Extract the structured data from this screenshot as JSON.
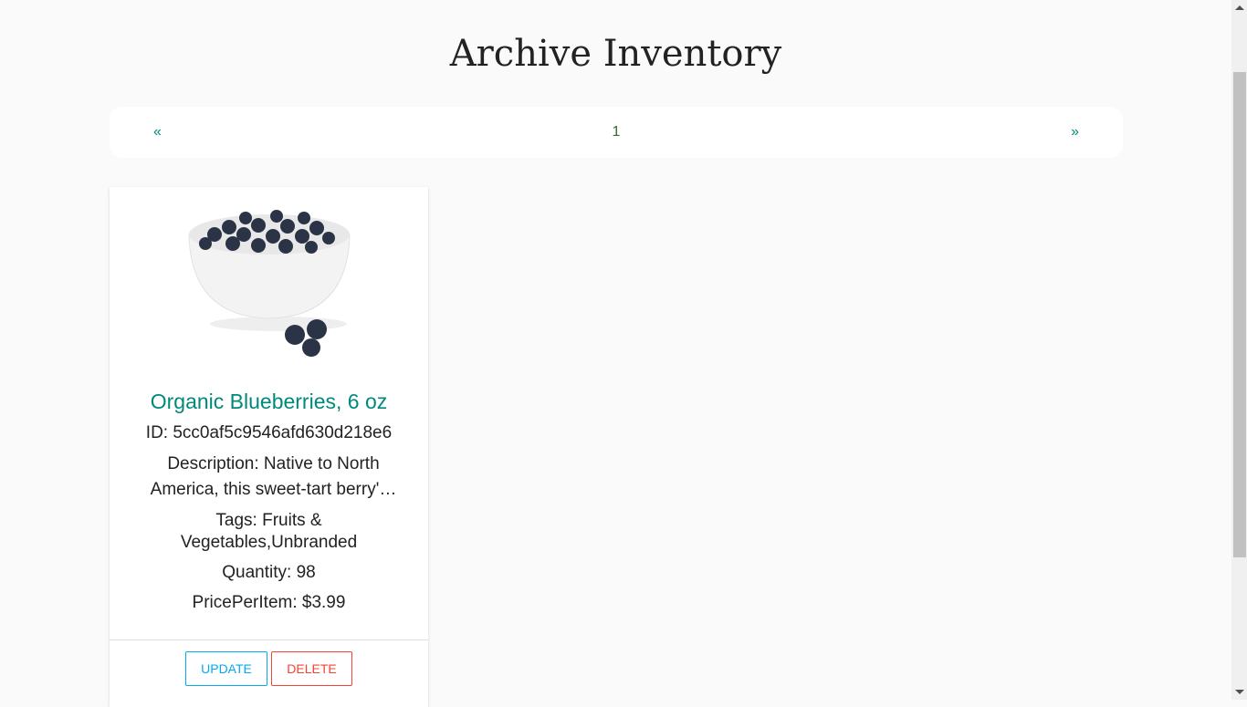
{
  "page": {
    "title": "Archive Inventory"
  },
  "pagination": {
    "prev": "«",
    "current": "1",
    "next": "»"
  },
  "items": [
    {
      "name": "Organic Blueberries, 6 oz",
      "id": "ID: 5cc0af5c9546afd630d218e6",
      "description": "Description: Native to North America, this sweet-tart berry'…",
      "tags": "Tags: Fruits & Vegetables,Unbranded",
      "quantity": "Quantity: 98",
      "price": "PricePerItem: $3.99",
      "update_label": "UPDATE",
      "delete_label": "DELETE"
    }
  ],
  "colors": {
    "accent": "#00897b",
    "update": "#03a9f4",
    "delete": "#f44336"
  }
}
